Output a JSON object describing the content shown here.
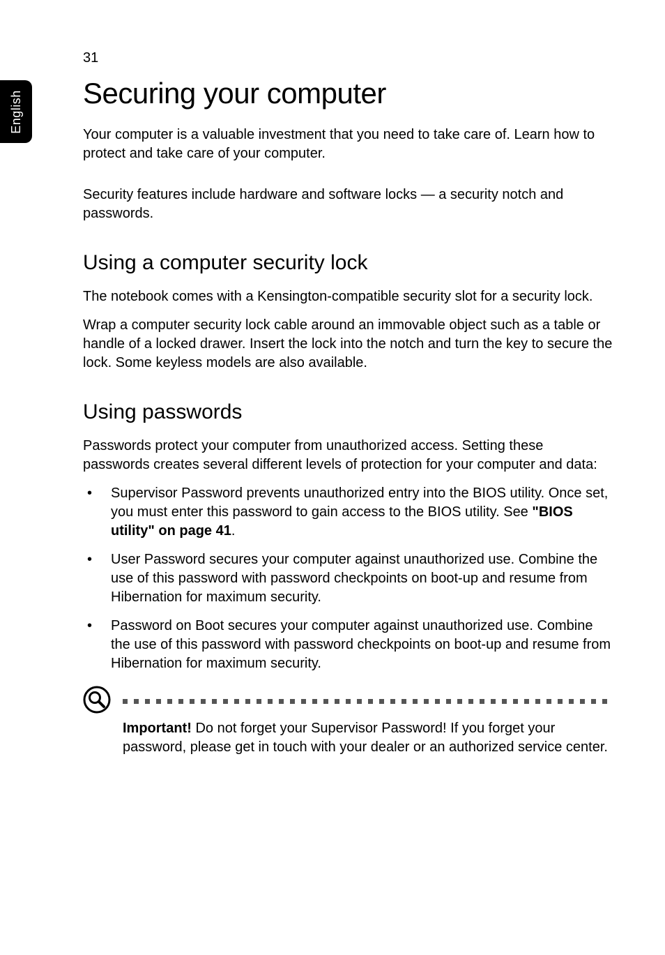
{
  "page_number": "31",
  "side_tab": "English",
  "h1": "Securing your computer",
  "intro_p1": "Your computer is a valuable investment that you need to take care of. Learn how to protect and take care of your computer.",
  "intro_p2": "Security features include hardware and software locks — a security notch and passwords.",
  "h2_lock": "Using a computer security lock",
  "lock_p1": "The notebook comes with a Kensington-compatible security slot for a security lock.",
  "lock_p2": "Wrap a computer security lock cable around an immovable object such as a table or handle of a locked drawer. Insert the lock into the notch and turn the key to secure the lock. Some keyless models are also available.",
  "h2_passwords": "Using passwords",
  "pw_intro": "Passwords protect your computer from unauthorized access. Setting these passwords creates several different levels of protection for your computer and data:",
  "bullet1_a": "Supervisor Password prevents unauthorized entry into the BIOS utility. Once set, you must enter this password to gain access to the BIOS utility. See ",
  "bullet1_link": "\"BIOS utility\" on page 41",
  "bullet1_b": ".",
  "bullet2": "User Password secures your computer against unauthorized use. Combine the use of this password with password checkpoints on boot-up and resume from Hibernation for maximum security.",
  "bullet3": "Password on Boot secures your computer against unauthorized use. Combine the use of this password with password checkpoints on boot-up and resume from Hibernation for maximum security.",
  "note_label": "Important!",
  "note_text": " Do not forget your Supervisor Password! If you forget your password, please get in touch with your dealer or an authorized service center."
}
